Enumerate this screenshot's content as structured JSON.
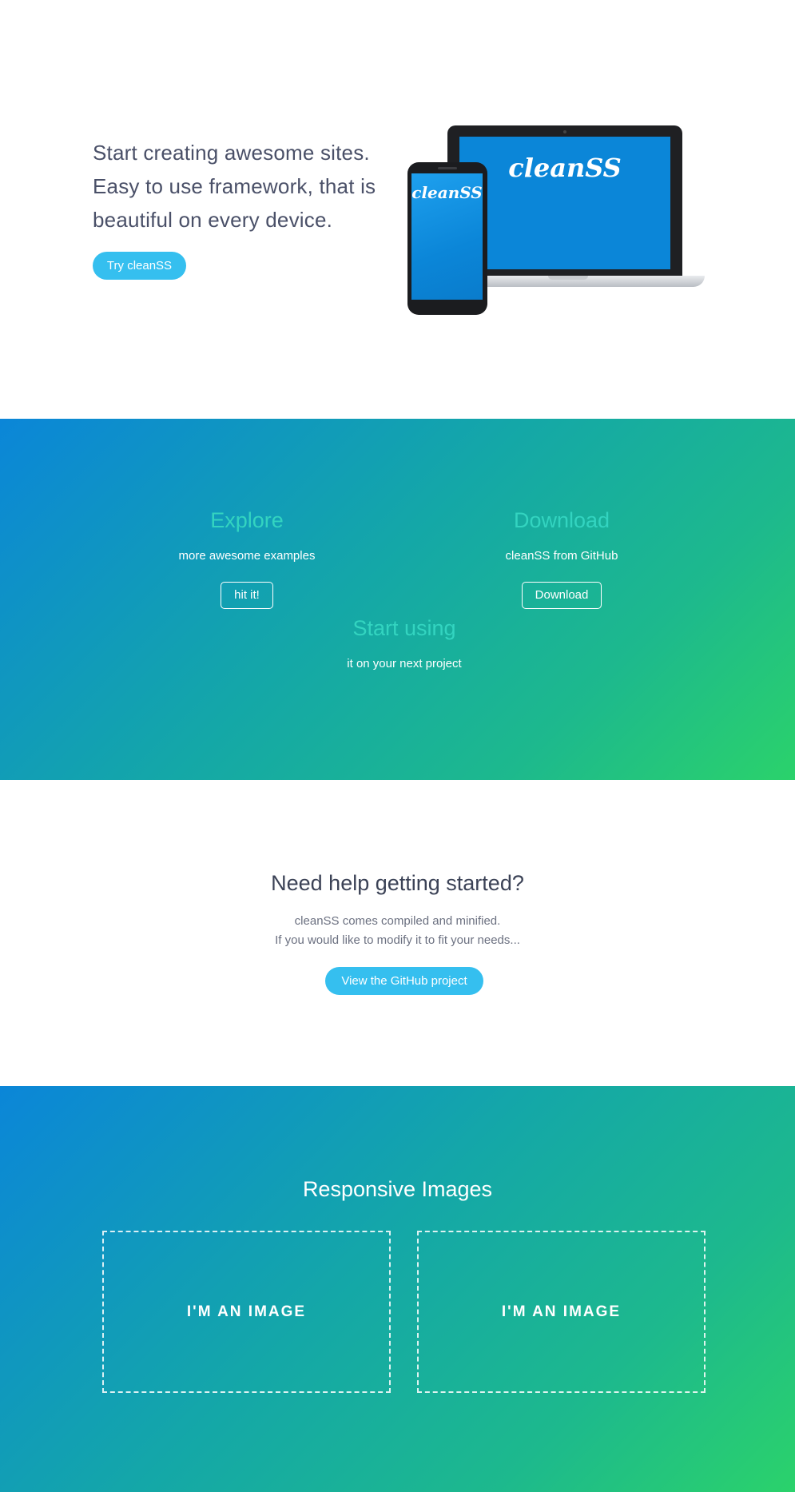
{
  "hero": {
    "headline": [
      "Start creating awesome sites.",
      "Easy to use framework, that is",
      "beautiful on every device."
    ],
    "cta_label": "Try cleanSS",
    "device_logo": "cleanSS"
  },
  "features": [
    {
      "title": "Explore",
      "text": "more awesome examples",
      "button": "hit it!"
    },
    {
      "title": "Download",
      "text": "cleanSS from GitHub",
      "button": "Download"
    },
    {
      "title": "Start using",
      "text": "it on your next project"
    }
  ],
  "help": {
    "title": "Need help getting started?",
    "lines": [
      "cleanSS comes compiled and minified.",
      "If you would like to modify it to fit your needs..."
    ],
    "button": "View the GitHub project"
  },
  "images": {
    "title": "Responsive Images",
    "placeholders": [
      "I'M AN IMAGE",
      "I'M AN IMAGE"
    ]
  },
  "colors": {
    "accent": "#35bfef",
    "feature_title": "#33d4c0",
    "gradient_start": "#0b86d8",
    "gradient_end": "#2bd26b",
    "text_dark": "#3b4256"
  }
}
